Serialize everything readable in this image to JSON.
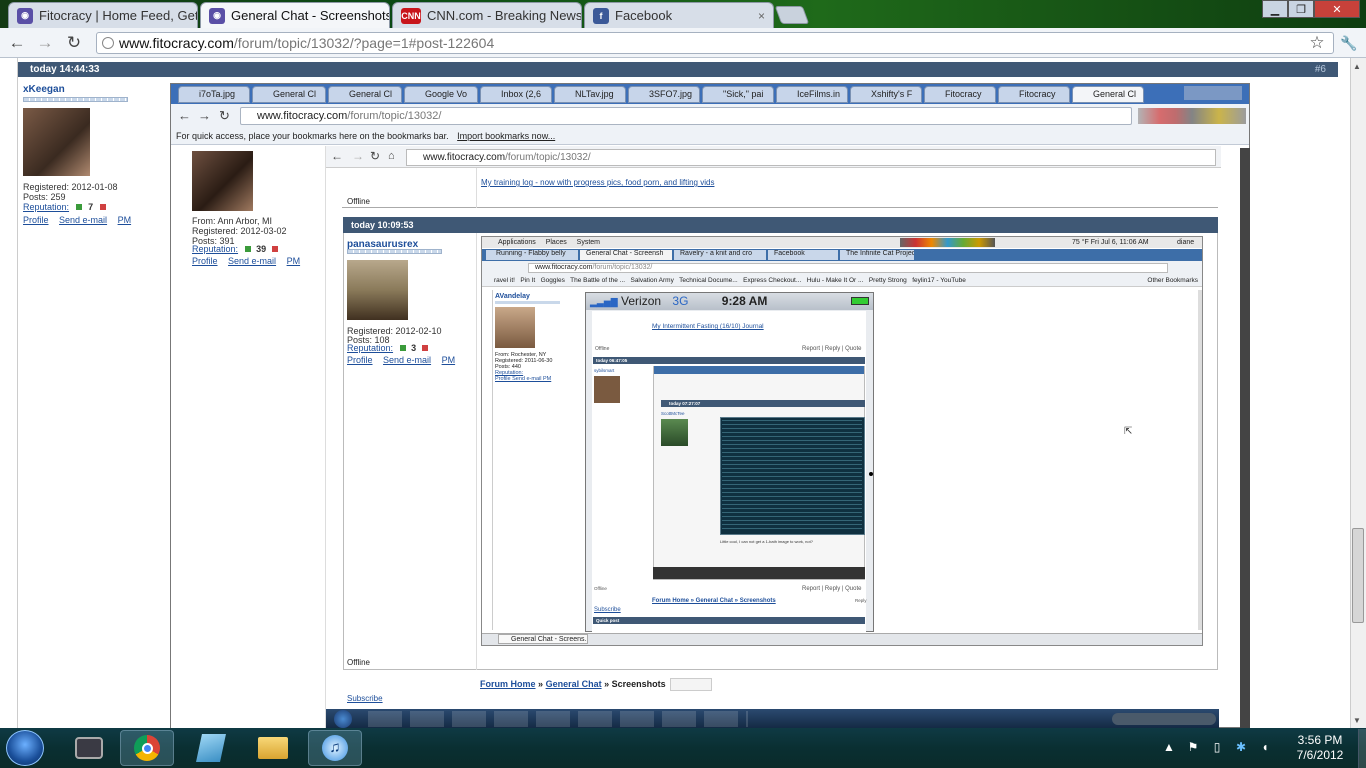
{
  "browser": {
    "tabs": [
      {
        "label": "Fitocracy | Home Feed, Get",
        "icon": "fitocracy-icon",
        "active": false
      },
      {
        "label": "General Chat - Screenshots",
        "icon": "fitocracy-icon",
        "active": true
      },
      {
        "label": "CNN.com - Breaking News",
        "icon": "cnn-icon",
        "active": false
      },
      {
        "label": "Facebook",
        "icon": "facebook-icon",
        "active": false
      }
    ],
    "tab_close": "×",
    "cnn_badge": "CNN",
    "fb_badge": "f",
    "window_controls": {
      "minimize": "▁",
      "maximize": "❐",
      "close": "✕"
    },
    "nav": {
      "back": "←",
      "forward": "→",
      "reload": "↻",
      "star": "☆",
      "wrench": "🔧"
    },
    "url_host": "www.fitocracy.com",
    "url_path": "/forum/topic/13032/?page=1#post-122604"
  },
  "forum": {
    "post_header": {
      "time": "today 14:44:33",
      "post_number": "#6"
    },
    "author": {
      "name": "xKeegan",
      "registered": "Registered:  2012-01-08",
      "posts": "Posts:  259",
      "reputation_label": "Reputation:",
      "reputation_value": "7",
      "profile": "Profile",
      "send_email": "Send e-mail",
      "pm": "PM"
    }
  },
  "nested1": {
    "tabs": [
      "i7oTa.jpg",
      "General Cl",
      "General Cl",
      "Google Vo",
      "Inbox (2,6",
      "NLTav.jpg",
      "3SFO7.jpg",
      "\"Sick,\" pai",
      "IceFilms.in",
      "Xshifty's F",
      "Fitocracy",
      "Fitocracy",
      "General Cl"
    ],
    "url_host": "www.fitocracy.com",
    "url_path": "/forum/topic/13032/",
    "bookmarks_text": "For quick access, place your bookmarks here on the bookmarks bar.",
    "import_link": "Import bookmarks now...",
    "prev_author": {
      "from": "From:  Ann Arbor, MI",
      "registered": "Registered:  2012-03-02",
      "posts": "Posts:  391",
      "reputation_label": "Reputation:",
      "reputation_value": "39",
      "profile": "Profile",
      "send_email": "Send e-mail",
      "pm": "PM"
    },
    "training_log": "My training log - now with progress pics, food porn, and lifting vids",
    "offline": "Offline",
    "post_time": "today 10:09:53",
    "author": {
      "name": "panasaurusrex",
      "registered": "Registered:  2012-02-10",
      "posts": "Posts:  108",
      "reputation_label": "Reputation:",
      "reputation_value": "3",
      "profile": "Profile",
      "send_email": "Send e-mail",
      "pm": "PM"
    },
    "offline2": "Offline",
    "breadcrumb": {
      "home": "Forum Home",
      "sep": "»",
      "chat": "General Chat",
      "sep2": "»",
      "current": "Screenshots"
    },
    "subscribe": "Subscribe"
  },
  "nested2": {
    "menu": [
      "Applications",
      "Places",
      "System"
    ],
    "tray": "75 °F  Fri Jul  6, 11:06 AM",
    "user": "diane",
    "tabs": [
      "Running - Flabby belly",
      "General Chat - Screensh",
      "Ravelry - a knit and cro",
      "Facebook",
      "The Infinite Cat Project"
    ],
    "url_host": "www.fitocracy.com",
    "url_path": "/forum/topic/13032/",
    "bookmarks": [
      "ravel it!",
      "Pin It",
      "Goggles",
      "The Battle of the ...",
      "Salvation Army",
      "Technical Docume...",
      "Express Checkout...",
      "Hulu - Make It Or ...",
      "Pretty Strong",
      "feylin17 - YouTube"
    ],
    "other_bookmarks": "Other Bookmarks",
    "author_name": "AVandelay",
    "author_info": [
      "From:  Rochester, NY",
      "Registered:  2011-06-30",
      "Posts:  440",
      "Reputation:",
      "Profile   Send e-mail   PM"
    ],
    "taskbar_label": "General Chat - Screens...",
    "phone": {
      "carrier": "Verizon",
      "network": "3G",
      "time": "9:28 AM",
      "fasting": "My Intermittent Fasting (16/10) Journal",
      "post_actions": "Report | Reply | Quote",
      "offline": "Offline",
      "post_time": "today 06:47:05",
      "inner_author": "sybilsmart",
      "inner_time": "today 07:27:07",
      "inner_author2": "ScottMcTee",
      "caption": "Little cool, I can not get a 1-bath image to work, not?",
      "breadcrumb": "Forum Home » General Chat » Screenshots",
      "subscribe": "Subscribe",
      "quick_post": "Quick post",
      "reply": "Reply"
    }
  },
  "nested1_breadcrumb_bottom": "Forum Home » General Chat » Screenshots",
  "taskbar": {
    "clock_time": "3:56 PM",
    "clock_date": "7/6/2012",
    "apps": [
      "camera-app-icon",
      "chrome-icon",
      "notepad-icon",
      "explorer-icon",
      "itunes-icon"
    ]
  }
}
